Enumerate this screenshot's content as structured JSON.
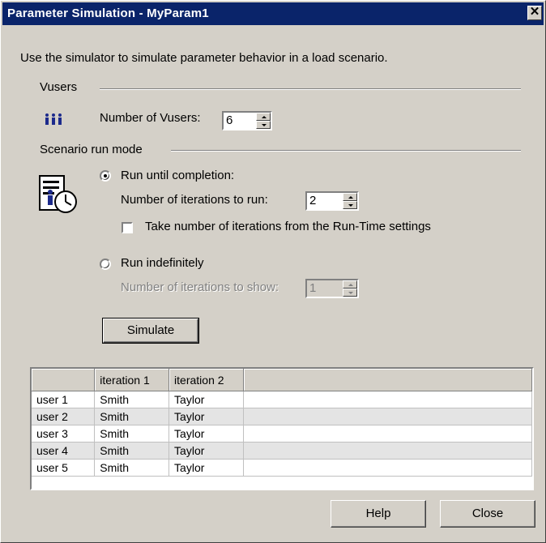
{
  "window": {
    "title": "Parameter Simulation - MyParam1",
    "close_glyph": "✕"
  },
  "intro": "Use the simulator to simulate parameter behavior in a load scenario.",
  "vusers": {
    "group_label": "Vusers",
    "icon": "vusers-icon",
    "count_label": "Number of Vusers:",
    "count_value": "6"
  },
  "run_mode": {
    "group_label": "Scenario run mode",
    "icon": "scenario-schedule-icon",
    "completion_label": "Run until completion:",
    "completion_selected": true,
    "iterations_label": "Number of iterations to run:",
    "iterations_value": "2",
    "runtime_checkbox_label": "Take number of iterations from the Run-Time settings",
    "runtime_checked": false,
    "indefinite_label": "Run indefinitely",
    "indefinite_selected": false,
    "show_label": "Number of iterations to show:",
    "show_value": "1"
  },
  "simulate_label": "Simulate",
  "grid": {
    "columns": [
      "",
      "iteration 1",
      "iteration 2",
      ""
    ],
    "rows": [
      {
        "user": "user 1",
        "it1": "Smith",
        "it2": "Taylor"
      },
      {
        "user": "user 2",
        "it1": "Smith",
        "it2": "Taylor"
      },
      {
        "user": "user 3",
        "it1": "Smith",
        "it2": "Taylor"
      },
      {
        "user": "user 4",
        "it1": "Smith",
        "it2": "Taylor"
      },
      {
        "user": "user 5",
        "it1": "Smith",
        "it2": "Taylor"
      }
    ]
  },
  "footer": {
    "help_label": "Help",
    "close_label": "Close"
  }
}
